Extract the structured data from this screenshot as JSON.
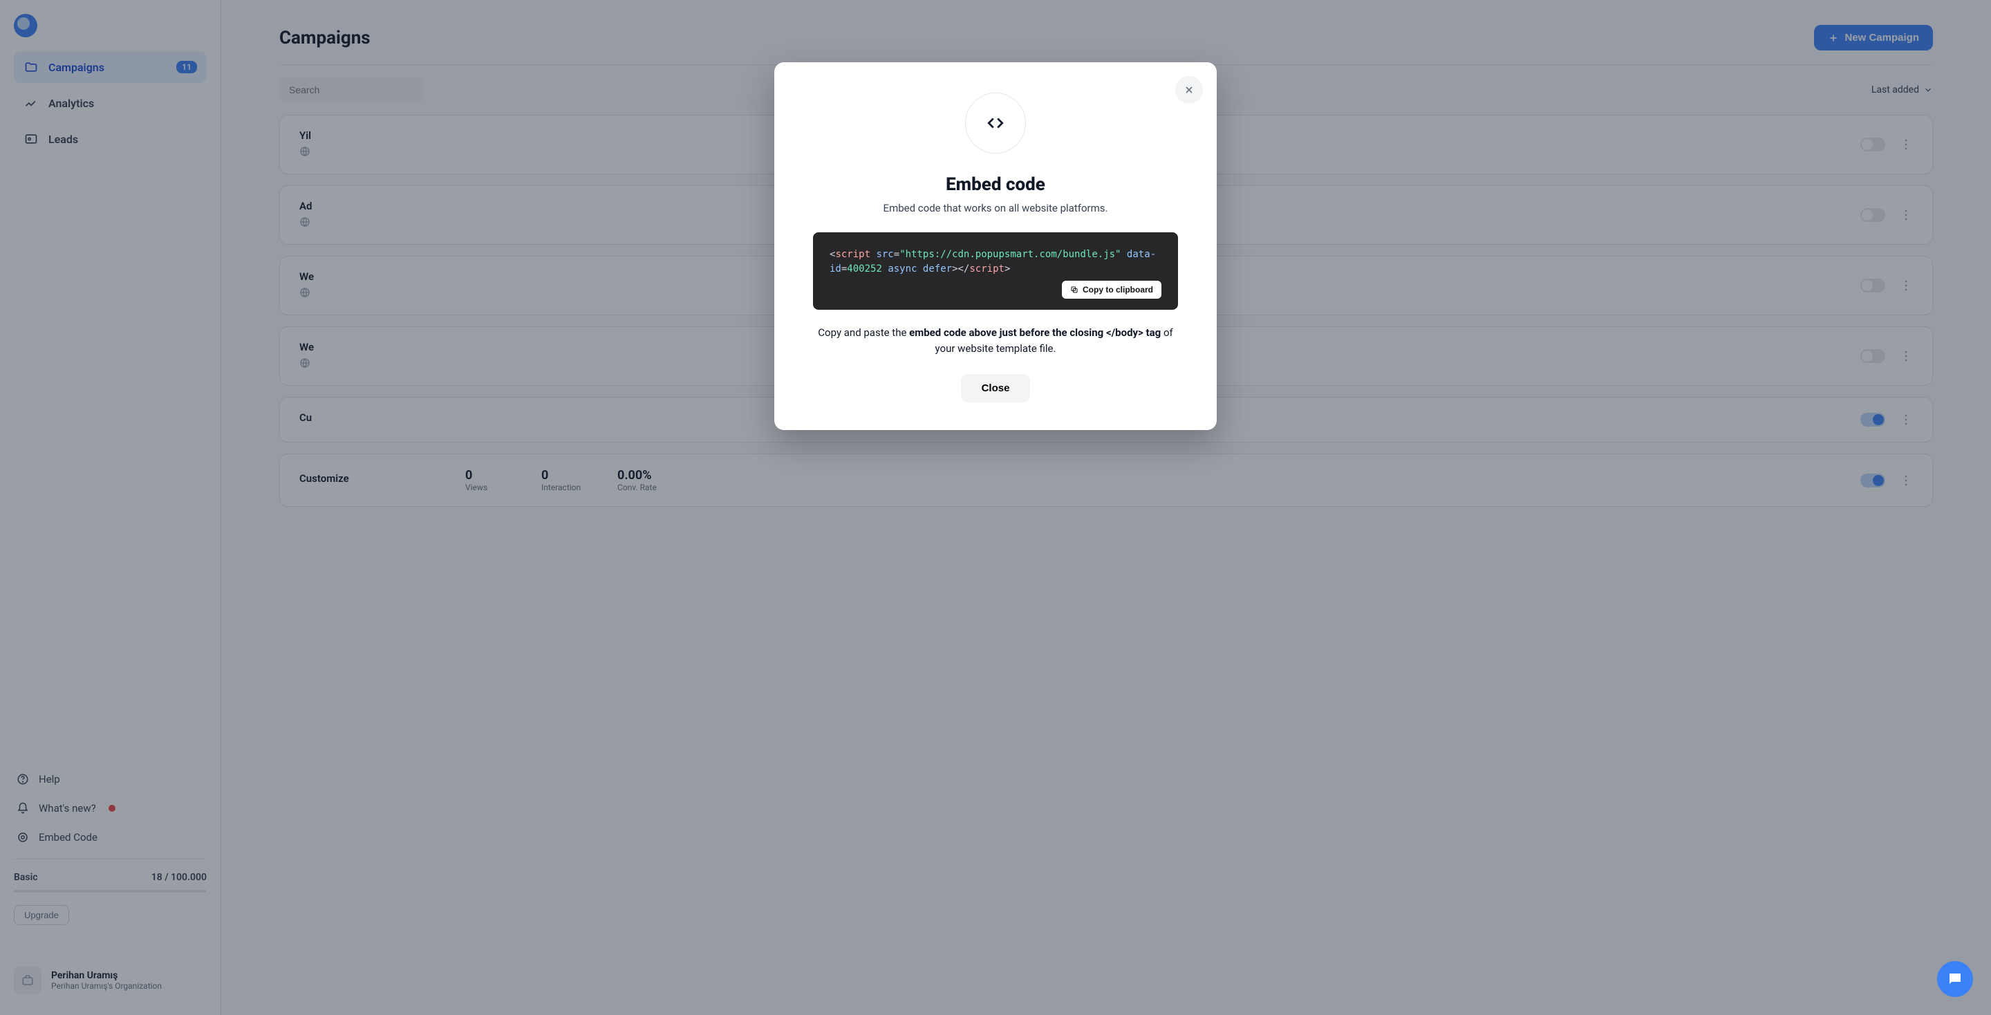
{
  "sidebar": {
    "nav": {
      "campaigns": {
        "label": "Campaigns",
        "badge": "11"
      },
      "analytics": {
        "label": "Analytics"
      },
      "leads": {
        "label": "Leads"
      }
    },
    "lower": {
      "help": "Help",
      "whatsnew": "What's new?",
      "embed": "Embed Code"
    },
    "plan": {
      "name": "Basic",
      "usage": "18 / 100.000",
      "upgrade": "Upgrade"
    },
    "user": {
      "name": "Perihan Uramış",
      "org": "Perihan Uramış's Organization"
    }
  },
  "main": {
    "title": "Campaigns",
    "new_button": "New Campaign",
    "search_placeholder": "Search",
    "sort_label": "Last added"
  },
  "campaigns": [
    {
      "name": "Yil",
      "views": "",
      "interaction": "",
      "rate": "",
      "toggle": false
    },
    {
      "name": "Ad",
      "views": "",
      "interaction": "",
      "rate": "",
      "toggle": false
    },
    {
      "name": "We",
      "views": "",
      "interaction": "",
      "rate": "",
      "toggle": false
    },
    {
      "name": "We",
      "views": "",
      "interaction": "",
      "rate": "",
      "toggle": false
    },
    {
      "name": "Cu",
      "views": "",
      "interaction": "",
      "rate": "",
      "toggle": true
    },
    {
      "name": "Customize",
      "views": "0",
      "views_label": "Views",
      "interaction": "0",
      "interaction_label": "Interaction",
      "rate": "0.00%",
      "rate_label": "Conv. Rate",
      "toggle": true
    }
  ],
  "modal": {
    "title": "Embed code",
    "subtitle": "Embed code that works on all website platforms.",
    "code": {
      "open_bracket": "<",
      "tag": "script",
      "src_attr": "src",
      "eq": "=",
      "src_val": "\"https://cdn.popupsmart.com/bundle.js\"",
      "data_attr": "data-id",
      "data_val": "400252",
      "async": "async",
      "defer": "defer",
      "close1": ">",
      "close_slash": "</",
      "close2": ">"
    },
    "copy_label": "Copy to clipboard",
    "desc_prefix": "Copy and paste the ",
    "desc_bold": "embed code above just before the closing </body> tag",
    "desc_suffix": " of your website template file.",
    "close_button": "Close"
  }
}
